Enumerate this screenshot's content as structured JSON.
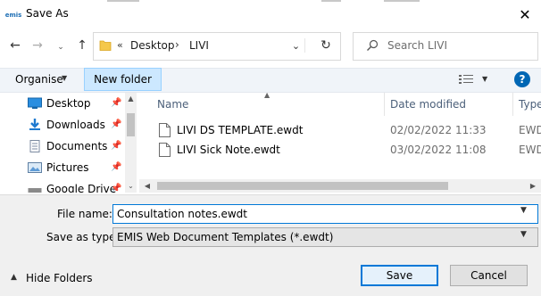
{
  "window": {
    "title": "Save As"
  },
  "navigation": {
    "back_icon": "arrow-left-icon",
    "forward_icon": "arrow-right-icon",
    "recent_icon": "chevron-down-icon",
    "up_icon": "arrow-up-icon"
  },
  "address": {
    "overflow_glyph": "«",
    "crumbs": [
      "Desktop",
      "LIVI"
    ],
    "separator": "›"
  },
  "search": {
    "placeholder": "Search LIVI"
  },
  "toolbar": {
    "organise_label": "Organise",
    "new_folder_label": "New folder",
    "help_label": "?"
  },
  "sidebar": {
    "items": [
      {
        "label": "Desktop",
        "icon": "desktop-icon",
        "pinned": true
      },
      {
        "label": "Downloads",
        "icon": "download-icon",
        "pinned": true
      },
      {
        "label": "Documents",
        "icon": "documents-icon",
        "pinned": true
      },
      {
        "label": "Pictures",
        "icon": "pictures-icon",
        "pinned": true
      },
      {
        "label": "Google Drive",
        "icon": "google-drive-icon",
        "pinned": true
      }
    ]
  },
  "file_list": {
    "columns": {
      "name": "Name",
      "date_modified": "Date modified",
      "type": "Type"
    },
    "rows": [
      {
        "name": "LIVI DS TEMPLATE.ewdt",
        "date_modified": "02/02/2022 11:33",
        "type": "EWDT"
      },
      {
        "name": "LIVI Sick Note.ewdt",
        "date_modified": "03/02/2022 11:08",
        "type": "EWDT"
      }
    ]
  },
  "form": {
    "file_name_label": "File name:",
    "file_name_value": "Consultation notes.ewdt",
    "save_as_type_label": "Save as type:",
    "save_as_type_value": "EMIS Web Document Templates (*.ewdt)"
  },
  "footer": {
    "hide_folders_label": "Hide Folders",
    "save_label": "Save",
    "cancel_label": "Cancel"
  },
  "colors": {
    "accent": "#0078d7",
    "selected_button_bg": "#cce8ff",
    "toolbar_bg": "#f0f4f9",
    "help_icon": "#0066b4",
    "column_header": "#4c607a"
  }
}
